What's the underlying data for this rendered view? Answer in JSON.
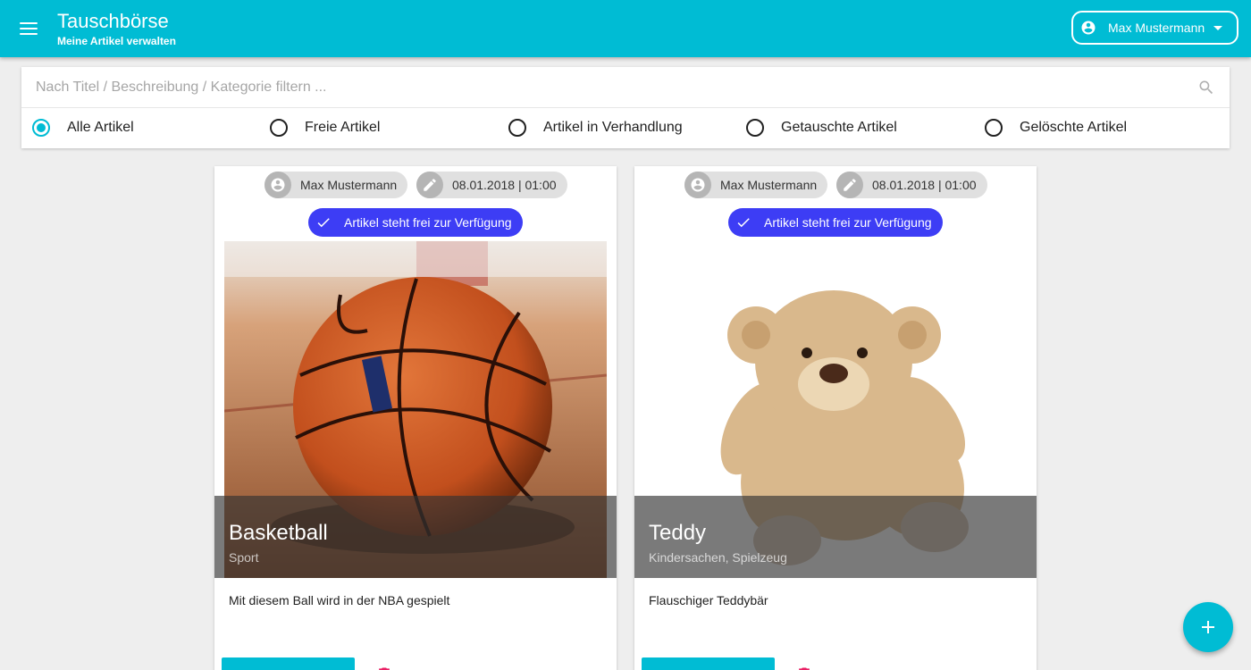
{
  "header": {
    "title": "Tauschbörse",
    "subtitle": "Meine Artikel verwalten",
    "user_name": "Max Mustermann"
  },
  "filter": {
    "search_placeholder": "Nach Titel / Beschreibung / Kategorie filtern ...",
    "search_value": "",
    "options": [
      {
        "label": "Alle Artikel",
        "selected": true
      },
      {
        "label": "Freie Artikel",
        "selected": false
      },
      {
        "label": "Artikel in Verhandlung",
        "selected": false
      },
      {
        "label": "Getauschte Artikel",
        "selected": false
      },
      {
        "label": "Gelöschte Artikel",
        "selected": false
      }
    ]
  },
  "cards": [
    {
      "owner": "Max Mustermann",
      "date": "08.01.2018 | 01:00",
      "status": "Artikel steht frei zur Verfügung",
      "title": "Basketball",
      "category": "Sport",
      "description": "Mit diesem Ball wird in der NBA gespielt",
      "image": "basketball"
    },
    {
      "owner": "Max Mustermann",
      "date": "08.01.2018 | 01:00",
      "status": "Artikel steht frei zur Verfügung",
      "title": "Teddy",
      "category": "Kindersachen, Spielzeug",
      "description": "Flauschiger Teddybär",
      "image": "teddy"
    }
  ],
  "icons": {
    "menu": "menu-icon",
    "account": "account-circle-icon",
    "edit": "pencil-icon",
    "check": "check-icon",
    "search": "search-icon",
    "delete": "trash-icon",
    "add": "plus-icon"
  },
  "colors": {
    "primary": "#00bcd4",
    "status_chip": "#3d3df5",
    "delete": "#e91e63",
    "background": "#eeeeee"
  }
}
